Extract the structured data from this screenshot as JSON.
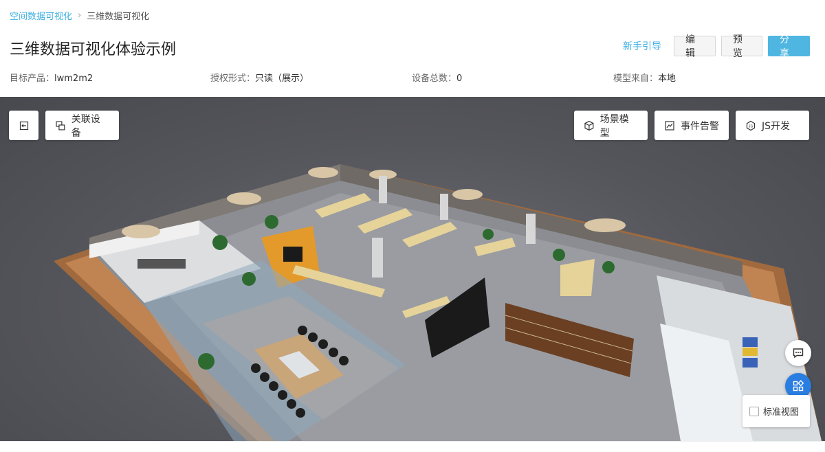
{
  "breadcrumb": {
    "parent": "空间数据可视化",
    "separator": "›",
    "current": "三维数据可视化"
  },
  "page_title": "三维数据可视化体验示例",
  "header_actions": {
    "guide": "新手引导",
    "edit": "编辑",
    "preview": "预览",
    "share": "分享"
  },
  "info": {
    "product_label": "目标产品：",
    "product_value": "lwm2m2",
    "auth_label": "授权形式：",
    "auth_value": "只读（展示）",
    "devices_label": "设备总数：",
    "devices_value": "0",
    "model_label": "模型来自：",
    "model_value": "本地"
  },
  "toolbar": {
    "exit_icon": "exit-icon",
    "link_devices": "关联设备",
    "scene_model": "场景模型",
    "event_alarm": "事件告警",
    "js_dev": "JS开发"
  },
  "view_panel": {
    "standard_view": "标准视图",
    "checked": false
  },
  "colors": {
    "accent": "#3fb1e3",
    "primary_button": "#4eb6e1",
    "apps_button": "#2a7de1",
    "viewer_bg": "#55565c"
  }
}
